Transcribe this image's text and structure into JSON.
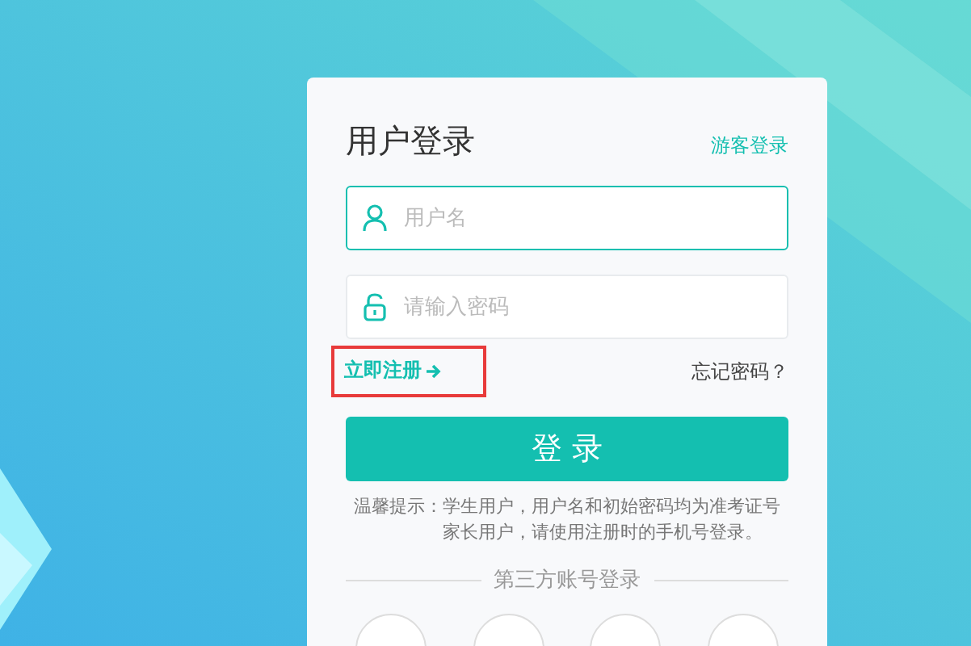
{
  "login_card": {
    "title": "用户登录",
    "guest_login": "游客登录",
    "fields": [
      {
        "kind": "username",
        "placeholder": "用户名",
        "focused": true
      },
      {
        "kind": "password",
        "placeholder": "请输入密码",
        "focused": false
      }
    ],
    "register_link": {
      "label": "立即注册",
      "highlighted": true
    },
    "forgot_password": "忘记密码？",
    "login_button": "登 录",
    "hint": {
      "label": "温馨提示：",
      "lines": [
        "学生用户，用户名和初始密码均为准考证号",
        "家长用户，请使用注册时的手机号登录。"
      ]
    },
    "third_party_title": "第三方账号登录"
  }
}
